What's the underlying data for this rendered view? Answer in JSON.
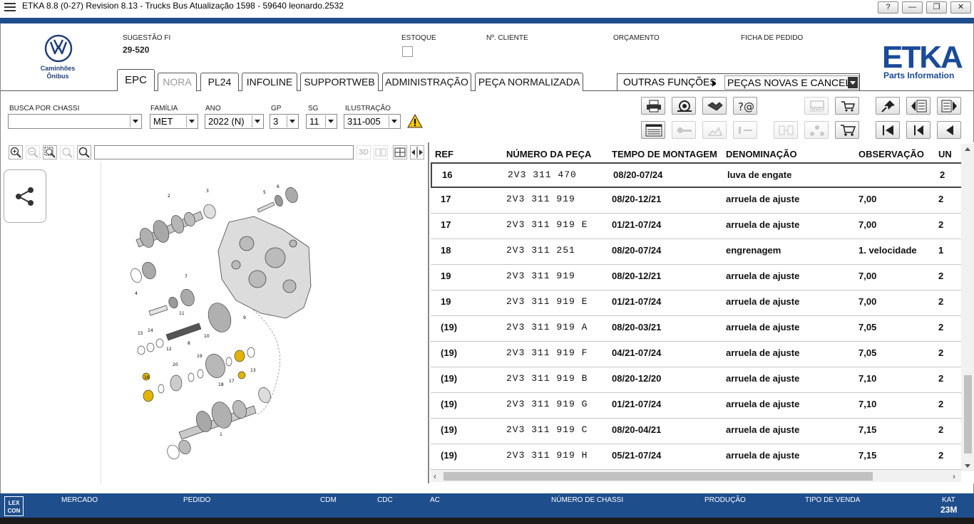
{
  "window": {
    "title": "ETKA 8.8 (0-27) Revision 8.13 - Trucks  Bus Atualização 1598 - 59640 leonardo.2532",
    "help_label": "?",
    "minimize_label": "—",
    "restore_label": "❐",
    "close_label": "✕"
  },
  "brand": {
    "line1": "Caminhões",
    "line2": "Ônibus",
    "etka": "ETKA",
    "etka_sub": "Parts Information",
    "color": "#1a4b99"
  },
  "header": {
    "sugestao_label": "SUGESTÃO FI",
    "sugestao_value": "29-520",
    "estoque_label": "ESTOQUE",
    "cliente_label": "Nº. CLIENTE",
    "orcamento_label": "ORÇAMENTO",
    "ficha_label": "FICHA DE PEDIDO"
  },
  "tabs": [
    {
      "label": "EPC",
      "state": "active"
    },
    {
      "label": "NORA",
      "state": "disabled"
    },
    {
      "label": "PL24",
      "state": "normal"
    },
    {
      "label": "INFOLINE",
      "state": "normal"
    },
    {
      "label": "SUPPORTWEB",
      "state": "normal"
    },
    {
      "label": "ADMINISTRAÇÃO",
      "state": "normal"
    },
    {
      "label": "PEÇA NORMALIZADA",
      "state": "normal"
    }
  ],
  "outras": {
    "label": "OUTRAS FUNÇÕES",
    "selected": "PEÇAS NOVAS E CANCEL."
  },
  "filters": {
    "chassi_label": "BUSCA POR CHASSI",
    "chassi_value": "",
    "familia_label": "FAMÍLIA",
    "familia_value": "MET",
    "ano_label": "ANO",
    "ano_value": "2022 (N)",
    "gp_label": "GP",
    "gp_value": "3",
    "sg_label": "SG",
    "sg_value": "11",
    "ilustracao_label": "ILUSTRAÇÃO",
    "ilustracao_value": "311-005"
  },
  "zoom_toolbar": {
    "search_value": "",
    "label_3d": "3D"
  },
  "table": {
    "headers": {
      "ref": "REF",
      "numero": "NÚMERO DA PEÇA",
      "tempo": "TEMPO DE MONTAGEM",
      "denominacao": "DENOMINAÇÃO",
      "observacao": "OBSERVAÇÃO",
      "un": "UN"
    },
    "rows": [
      {
        "ref": "16",
        "numero": "2V3 311 470",
        "tempo": "08/20-07/24",
        "denominacao": "luva de engate",
        "observacao": "",
        "un": "2"
      },
      {
        "ref": "17",
        "numero": "2V3 311 919",
        "tempo": "08/20-12/21",
        "denominacao": "arruela de ajuste",
        "observacao": "7,00",
        "un": "2"
      },
      {
        "ref": "17",
        "numero": "2V3 311 919 E",
        "tempo": "01/21-07/24",
        "denominacao": "arruela de ajuste",
        "observacao": "7,00",
        "un": "2"
      },
      {
        "ref": "18",
        "numero": "2V3 311 251",
        "tempo": "08/20-07/24",
        "denominacao": "engrenagem",
        "observacao": "1. velocidade",
        "un": "1"
      },
      {
        "ref": "19",
        "numero": "2V3 311 919",
        "tempo": "08/20-12/21",
        "denominacao": "arruela de ajuste",
        "observacao": "7,00",
        "un": "2"
      },
      {
        "ref": "19",
        "numero": "2V3 311 919 E",
        "tempo": "01/21-07/24",
        "denominacao": "arruela de ajuste",
        "observacao": "7,00",
        "un": "2"
      },
      {
        "ref": "(19)",
        "numero": "2V3 311 919 A",
        "tempo": "08/20-03/21",
        "denominacao": "arruela de ajuste",
        "observacao": "7,05",
        "un": "2"
      },
      {
        "ref": "(19)",
        "numero": "2V3 311 919 F",
        "tempo": "04/21-07/24",
        "denominacao": "arruela de ajuste",
        "observacao": "7,05",
        "un": "2"
      },
      {
        "ref": "(19)",
        "numero": "2V3 311 919 B",
        "tempo": "08/20-12/20",
        "denominacao": "arruela de ajuste",
        "observacao": "7,10",
        "un": "2"
      },
      {
        "ref": "(19)",
        "numero": "2V3 311 919 G",
        "tempo": "01/21-07/24",
        "denominacao": "arruela de ajuste",
        "observacao": "7,10",
        "un": "2"
      },
      {
        "ref": "(19)",
        "numero": "2V3 311 919 C",
        "tempo": "08/20-04/21",
        "denominacao": "arruela de ajuste",
        "observacao": "7,15",
        "un": "2"
      },
      {
        "ref": "(19)",
        "numero": "2V3 311 919 H",
        "tempo": "05/21-07/24",
        "denominacao": "arruela de ajuste",
        "observacao": "7,15",
        "un": "2"
      }
    ]
  },
  "statusbar": {
    "lex_line1": "LEX",
    "lex_line2": "CON",
    "mercado": "MERCADO",
    "pedido": "PEDIDO",
    "cdm": "CDM",
    "cdc": "CDC",
    "ac": "AC",
    "numero_chassi": "NÚMERO DE CHASSI",
    "producao": "PRODUÇÃO",
    "tipo_venda": "TIPO DE VENDA",
    "kat_label": "KAT",
    "kat_value": "23M"
  },
  "diagram_callouts": [
    "1",
    "2",
    "3",
    "4",
    "5",
    "6",
    "7",
    "8",
    "9",
    "10",
    "11",
    "12",
    "13",
    "14",
    "15",
    "16",
    "17",
    "18",
    "19",
    "20"
  ],
  "icons": [
    "print-icon",
    "parts-icon",
    "handshake-icon",
    "email-icon",
    "depot-icon",
    "cart-transfer-icon",
    "pin-icon",
    "page-prev-icon",
    "page-next-icon",
    "list-icon",
    "key-icon",
    "tools-icon",
    "minus-icon",
    "transfer-icon",
    "network-icon",
    "cart-icon",
    "first-icon",
    "prev-icon",
    "back-icon",
    "share-icon",
    "warning-icon"
  ],
  "colors": {
    "navy": "#1f4e8c",
    "highlight": "#e2b400"
  }
}
